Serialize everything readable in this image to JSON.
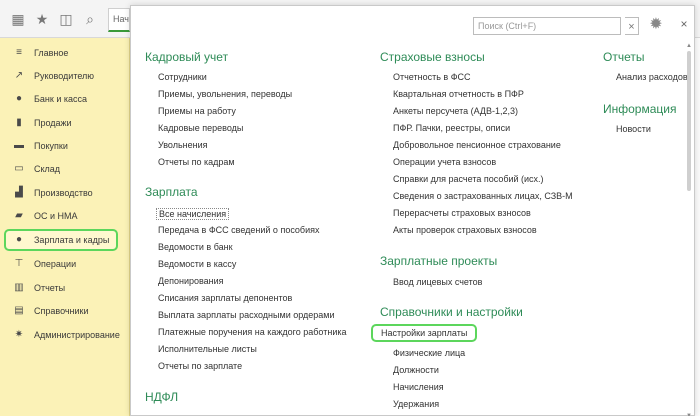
{
  "tab": {
    "label": "Начальная страница"
  },
  "sidebar": {
    "items": [
      {
        "label": "Главное",
        "icon": "menu-icon"
      },
      {
        "label": "Руководителю",
        "icon": "trend-icon"
      },
      {
        "label": "Банк и касса",
        "icon": "coin-icon"
      },
      {
        "label": "Продажи",
        "icon": "bag-icon"
      },
      {
        "label": "Покупки",
        "icon": "cart-icon"
      },
      {
        "label": "Склад",
        "icon": "warehouse-icon"
      },
      {
        "label": "Производство",
        "icon": "factory-icon"
      },
      {
        "label": "ОС и НМА",
        "icon": "truck-icon"
      },
      {
        "label": "Зарплата и кадры",
        "icon": "person-icon"
      },
      {
        "label": "Операции",
        "icon": "operations-icon"
      },
      {
        "label": "Отчеты",
        "icon": "chart-icon"
      },
      {
        "label": "Справочники",
        "icon": "book-icon"
      },
      {
        "label": "Администрирование",
        "icon": "gear-icon"
      }
    ]
  },
  "search": {
    "placeholder": "Поиск (Ctrl+F)"
  },
  "col1": {
    "kadr_title": "Кадровый учет",
    "kadr": [
      "Сотрудники",
      "Приемы, увольнения, переводы",
      "Приемы на работу",
      "Кадровые переводы",
      "Увольнения",
      "Отчеты по кадрам"
    ],
    "zp_title": "Зарплата",
    "zp": [
      "Все начисления",
      "Передача в ФСС сведений о пособиях",
      "Ведомости в банк",
      "Ведомости в кассу",
      "Депонирования",
      "Списания зарплаты депонентов",
      "Выплата зарплаты расходными ордерами",
      "Платежные поручения на каждого работника",
      "Исполнительные листы",
      "Отчеты по зарплате"
    ],
    "ndfl_title": "НДФЛ"
  },
  "col2": {
    "sv_title": "Страховые взносы",
    "sv": [
      "Отчетность в ФСС",
      "Квартальная отчетность в ПФР",
      "Анкеты персучета (АДВ-1,2,3)",
      "ПФР. Пачки, реестры, описи",
      "Добровольное пенсионное страхование",
      "Операции учета взносов",
      "Справки для расчета пособий (исх.)",
      "Сведения о застрахованных лицах, СЗВ-М",
      "Перерасчеты страховых взносов",
      "Акты проверок страховых взносов"
    ],
    "zpp_title": "Зарплатные проекты",
    "zpp": [
      "Ввод лицевых счетов"
    ],
    "spr_title": "Справочники и настройки",
    "spr": [
      "Настройки зарплаты",
      "Физические лица",
      "Должности",
      "Начисления",
      "Удержания"
    ]
  },
  "col3": {
    "rep_title": "Отчеты",
    "rep": [
      "Анализ расходов"
    ],
    "info_title": "Информация",
    "info": [
      "Новости"
    ]
  }
}
